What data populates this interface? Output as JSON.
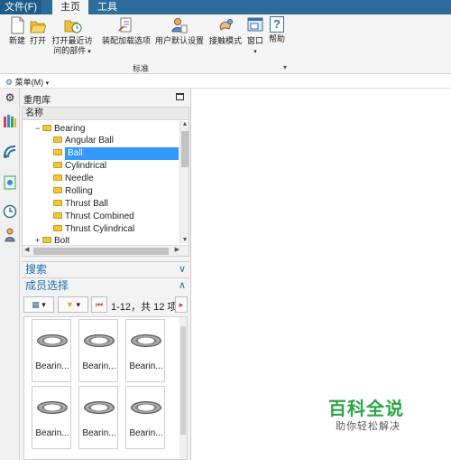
{
  "menubar": {
    "file": "文件(F)",
    "home": "主页",
    "tools": "工具"
  },
  "ribbon": {
    "new": "新建",
    "open": "打开",
    "open_recent_line1": "打开最近访",
    "open_recent_line2": "问的部件",
    "assembly_load": "装配加载选项",
    "user_defaults": "用户默认设置",
    "touch_mode": "接触模式",
    "window": "窗口",
    "help": "帮助",
    "help_glyph": "?",
    "group_label": "标准",
    "icons": [
      "new-icon",
      "open-icon",
      "open-recent-icon",
      "assembly-load-icon",
      "user-defaults-icon",
      "touch-mode-icon",
      "window-icon",
      "help-icon"
    ]
  },
  "menu_row": {
    "menu": "菜单(M)"
  },
  "reuse_library": {
    "title": "重用库",
    "column_header": "名称",
    "tree": [
      {
        "label": "Bearing",
        "level": 1,
        "expanded": true
      },
      {
        "label": "Angular Ball",
        "level": 2
      },
      {
        "label": "Ball",
        "level": 2,
        "selected": true
      },
      {
        "label": "Cylindrical",
        "level": 2
      },
      {
        "label": "Needle",
        "level": 2
      },
      {
        "label": "Rolling",
        "level": 2
      },
      {
        "label": "Thrust Ball",
        "level": 2
      },
      {
        "label": "Thrust Combined",
        "level": 2
      },
      {
        "label": "Thrust Cylindrical",
        "level": 2
      },
      {
        "label": "Bolt",
        "level": 1
      }
    ],
    "search_section": "搜索",
    "member_section": "成员选择",
    "range_text": "1-12，共 12 项",
    "members": [
      "Bearin...",
      "Bearin...",
      "Bearin...",
      "Bearin...",
      "Bearin...",
      "Bearin..."
    ]
  },
  "watermark": {
    "title": "百科全说",
    "subtitle": "助你轻松解决"
  },
  "colors": {
    "accent": "#2e6d9b",
    "selection": "#3399ff",
    "section_text": "#1f6fa8",
    "watermark": "#2aa646"
  }
}
